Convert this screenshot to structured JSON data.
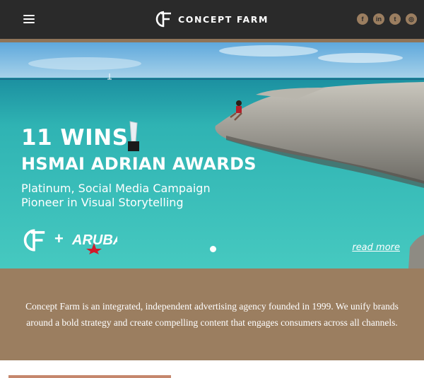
{
  "header": {
    "brand_name": "CONCEPT FARM",
    "menu_icon": "hamburger-menu-icon",
    "socials": [
      {
        "icon": "facebook-icon",
        "glyph": "f"
      },
      {
        "icon": "linkedin-icon",
        "glyph": "in"
      },
      {
        "icon": "twitter-icon",
        "glyph": "t"
      },
      {
        "icon": "instagram-icon",
        "glyph": "◎"
      }
    ]
  },
  "hero": {
    "headline": "11 WINS",
    "subheadline": "HSMAI ADRIAN AWARDS",
    "line1": "Platinum, Social Media Campaign",
    "line2": "Pioneer in Visual Storytelling",
    "plus": "+",
    "partner_logo_text": "ARUBA",
    "read_more": "read more",
    "slide_count": 1,
    "active_slide": 1
  },
  "intro": {
    "text": "Concept Farm is an integrated, independent advertising agency founded in 1999. We unify brands around a bold strategy and create compelling content that engages consumers across all channels."
  },
  "colors": {
    "header_bg": "#2a2a2a",
    "accent_brown": "#9b7e60",
    "sea": "#3fbfb8",
    "sky": "#6fb6de"
  }
}
